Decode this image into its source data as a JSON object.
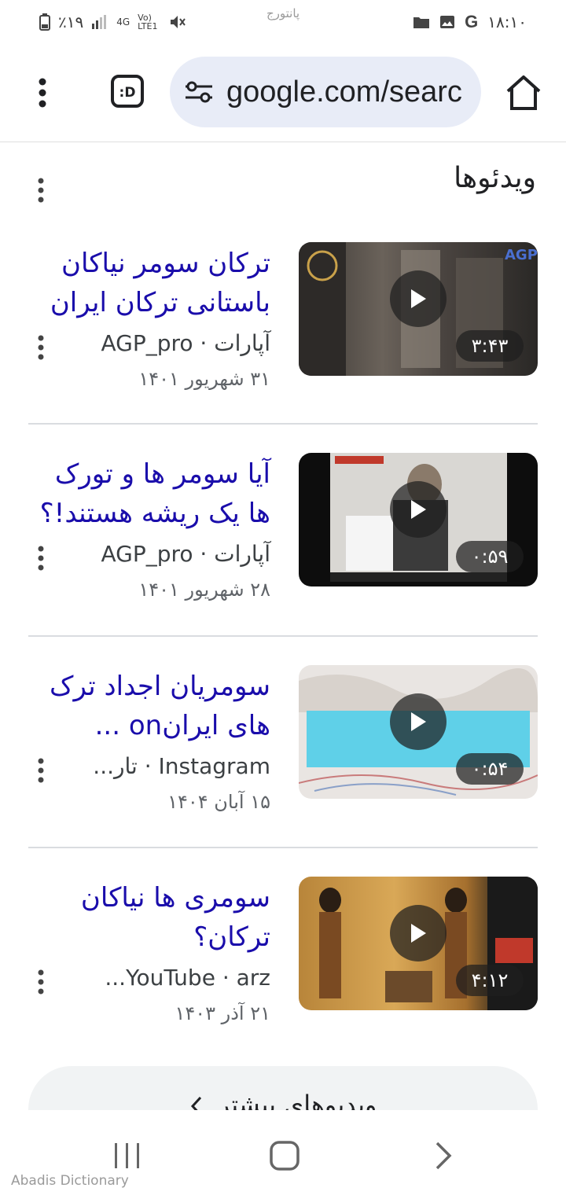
{
  "status_bar": {
    "carrier_label": "پانتورج",
    "battery_percent": "٪۱۹",
    "network": "4G",
    "lte": "Vo) LTE1",
    "time": "۱۸:۱۰"
  },
  "toolbar": {
    "url": "google.com/search"
  },
  "section": {
    "title": "ویدئوها"
  },
  "videos": [
    {
      "title": "ترکان سومر نیاکان باستانی ترکان ایران",
      "source": "آپارات · AGP_pro",
      "date": "۳۱ شهریور ۱۴۰۱",
      "duration": "۳:۴۳"
    },
    {
      "title": "آیا سومر ها و تورک ها یک ریشه هستند!؟",
      "source": "آپارات · AGP_pro",
      "date": "۲۸ شهریور ۱۴۰۱",
      "duration": "۰:۵۹"
    },
    {
      "title": "سومریان اجداد ترک های ایرانon ...",
      "source": "Instagram · تار...",
      "date": "۱۵ آبان ۱۴۰۴",
      "duration": "۰:۵۴"
    },
    {
      "title": "سومری ها نیاکان ترکان؟",
      "source": "YouTube · arz...",
      "date": "۲۱ آذر ۱۴۰۳",
      "duration": "۴:۱۲"
    }
  ],
  "more_videos_label": "ویدیوهای بیشتر",
  "watermark": "Abadis Dictionary"
}
